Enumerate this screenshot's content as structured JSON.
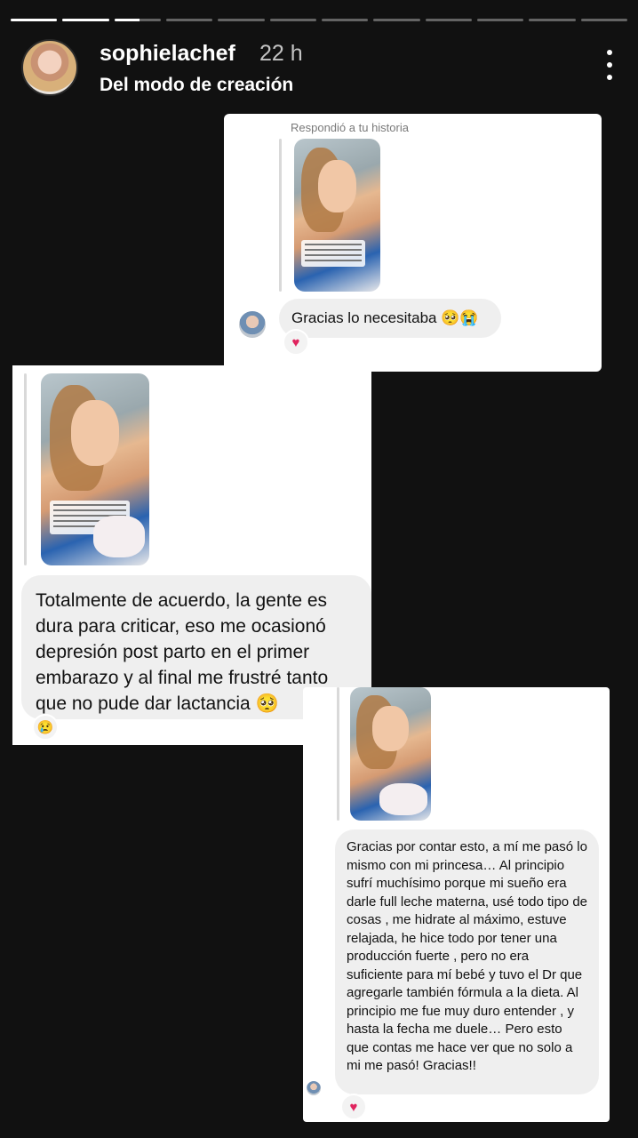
{
  "story": {
    "progress_segments": [
      1,
      1,
      0.55,
      0,
      0,
      0,
      0,
      0,
      0,
      0,
      0,
      0
    ],
    "username": "sophielachef",
    "time": "22 h",
    "subtitle": "Del modo de creación"
  },
  "screenshots": [
    {
      "reply_label": "Respondió a tu historia",
      "message": "Gracias lo necesitaba 🥺😭",
      "reaction": "♥"
    },
    {
      "message": "Totalmente de acuerdo, la gente es dura para criticar, eso me ocasionó depresión post parto en el primer embarazo y al final me frustré tanto que no pude dar lactancia 🥺",
      "reaction": "😢"
    },
    {
      "message": "Gracias por contar esto, a mí me pasó lo mismo con mi princesa… Al principio sufrí muchísimo porque mi sueño era darle full leche materna, usé todo tipo de cosas , me hidrate al máximo, estuve relajada, he hice todo por tener una producción fuerte , pero no era suficiente para mí bebé y tuvo el Dr que agregarle también fórmula a la dieta. Al principio me fue muy duro entender , y hasta la fecha me duele… Pero esto que contas me hace ver que no solo a mi me pasó! Gracias!!",
      "reaction": "♥"
    }
  ]
}
